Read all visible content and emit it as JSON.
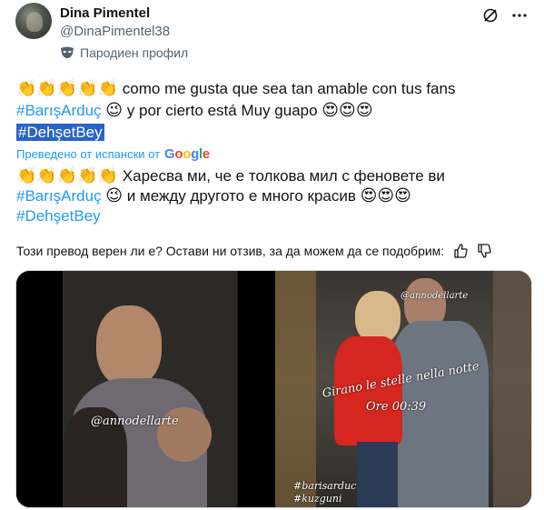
{
  "tweet": {
    "author": "Dina Pimentel",
    "handle": "@DinaPimentel38",
    "parody_label": "Пародиен профил",
    "original": {
      "clap_emojis": "👏👏👏👏👏",
      "line1": "como me gusta que sea tan amable con tus fans",
      "hashtag1": "#BarışArduç",
      "wink": "😉",
      "line2": "y por cierto está Muy guapo",
      "hearts": "😍😍😍",
      "hashtag2": "#DehşetBey"
    },
    "translated_label": "Преведено от испански от",
    "google_label": "Google",
    "translation": {
      "clap_emojis": "👏👏👏👏👏",
      "line1": "Харесва ми, че е толкова мил с феновете ви",
      "hashtag1": "#BarışArduç",
      "wink": "😉",
      "line2": "и между другото е много красив",
      "hearts": "😍😍😍",
      "hashtag2": "#DehşetBey"
    },
    "feedback_prompt": "Този превод верен ли е? Остави ни отзив, за да можем да се подобрим:",
    "media": {
      "left_watermark": "@annodellarte",
      "right_watermark_top": "@annodellarte",
      "right_caption1": "Girano le stelle nella notte",
      "right_caption2": "Ore 00:39",
      "right_tag1": "#barisarduc",
      "right_tag2": "#kuzguni"
    }
  },
  "colors": {
    "link": "#1d9bf0",
    "secondary_text": "#536471",
    "selection": "#2a63c9"
  }
}
